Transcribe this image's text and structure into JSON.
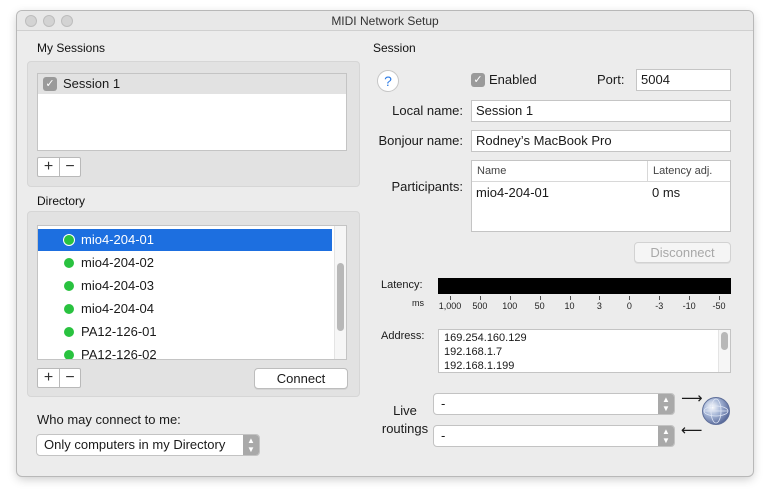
{
  "window": {
    "title": "MIDI Network Setup"
  },
  "my_sessions": {
    "label": "My Sessions",
    "items": [
      {
        "label": "Session 1",
        "checked": true
      }
    ],
    "add_label": "+",
    "remove_label": "−"
  },
  "directory": {
    "label": "Directory",
    "items": [
      {
        "label": "mio4-204-01",
        "status_color": "#29c23f"
      },
      {
        "label": "mio4-204-02",
        "status_color": "#29c23f"
      },
      {
        "label": "mio4-204-03",
        "status_color": "#29c23f"
      },
      {
        "label": "mio4-204-04",
        "status_color": "#29c23f"
      },
      {
        "label": "PA12-126-01",
        "status_color": "#29c23f"
      },
      {
        "label": "PA12-126-02",
        "status_color": "#29c23f"
      }
    ],
    "selected_index": 0,
    "add_label": "+",
    "remove_label": "−",
    "connect_label": "Connect"
  },
  "who_may_connect": {
    "label": "Who may connect to me:",
    "value": "Only computers in my Directory"
  },
  "session": {
    "label": "Session",
    "help_label": "?",
    "enabled_label": "Enabled",
    "enabled": true,
    "port_label": "Port:",
    "port_value": "5004",
    "local_name_label": "Local name:",
    "local_name_value": "Session 1",
    "bonjour_name_label": "Bonjour name:",
    "bonjour_name_value": "Rodney’s MacBook Pro",
    "participants_label": "Participants:",
    "participants_columns": [
      "Name",
      "Latency adj."
    ],
    "participants_rows": [
      {
        "name": "mio4-204-01",
        "latency": "0 ms"
      }
    ],
    "disconnect_label": "Disconnect",
    "latency_label": "Latency:",
    "latency_unit": "ms",
    "latency_ticks": [
      "1,000",
      "500",
      "100",
      "50",
      "10",
      "3",
      "0",
      "-3",
      "-10",
      "-50"
    ],
    "address_label": "Address:",
    "addresses": [
      "169.254.160.129",
      "192.168.1.7",
      "192.168.1.199"
    ],
    "live_routings_label_1": "Live",
    "live_routings_label_2": "routings",
    "routing_in_value": "-",
    "routing_out_value": "-"
  },
  "colors": {
    "selection": "#1d6fe0",
    "online": "#29c23f",
    "help_accent": "#2c7be5",
    "meter": "#000000"
  }
}
